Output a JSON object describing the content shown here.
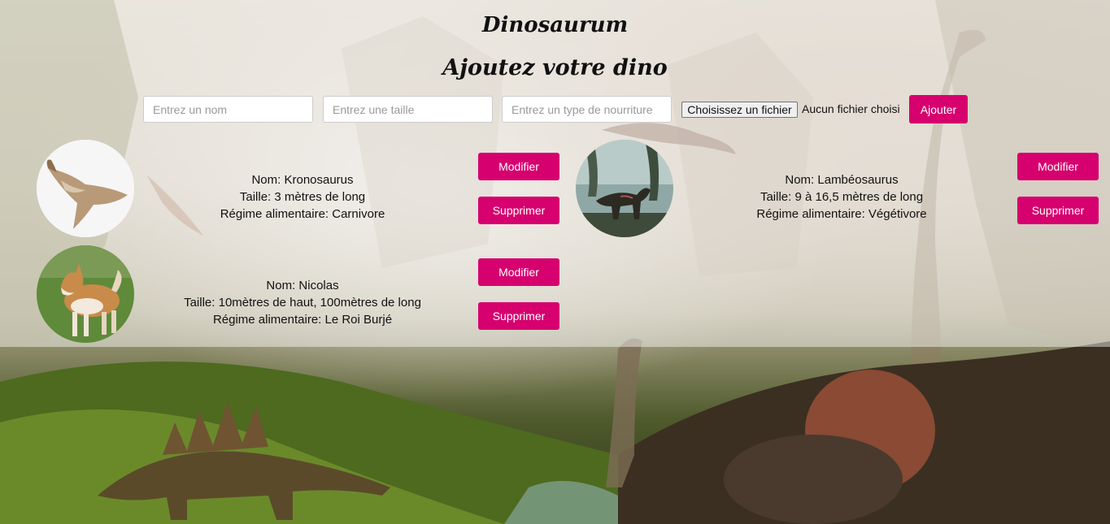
{
  "header": {
    "title": "Dinosaurum",
    "subtitle": "Ajoutez votre dino"
  },
  "form": {
    "name_placeholder": "Entrez un nom",
    "size_placeholder": "Entrez une taille",
    "food_placeholder": "Entrez un type de nourriture",
    "file_button_label": "Choisissez un fichier",
    "file_status": "Aucun fichier choisi",
    "submit_label": "Ajouter"
  },
  "buttons": {
    "modify_label": "Modifier",
    "delete_label": "Supprimer"
  },
  "dinos": [
    {
      "name": "Nom: Kronosaurus",
      "size": "Taille: 3 mètres de long",
      "diet": "Régime alimentaire: Carnivore",
      "image": "kronosaurus-photo"
    },
    {
      "name": "Nom: Lambéosaurus",
      "size": "Taille: 9 à 16,5 mètres de long",
      "diet": "Régime alimentaire: Végétivore",
      "image": "lambeosaurus-photo"
    },
    {
      "name": "Nom: Nicolas",
      "size": "Taille: 10mètres de haut, 100mètres de long",
      "diet": "Régime alimentaire: Le Roi Burjé",
      "image": "dog-photo"
    }
  ],
  "colors": {
    "accent": "#d6006e",
    "text": "#111111"
  }
}
